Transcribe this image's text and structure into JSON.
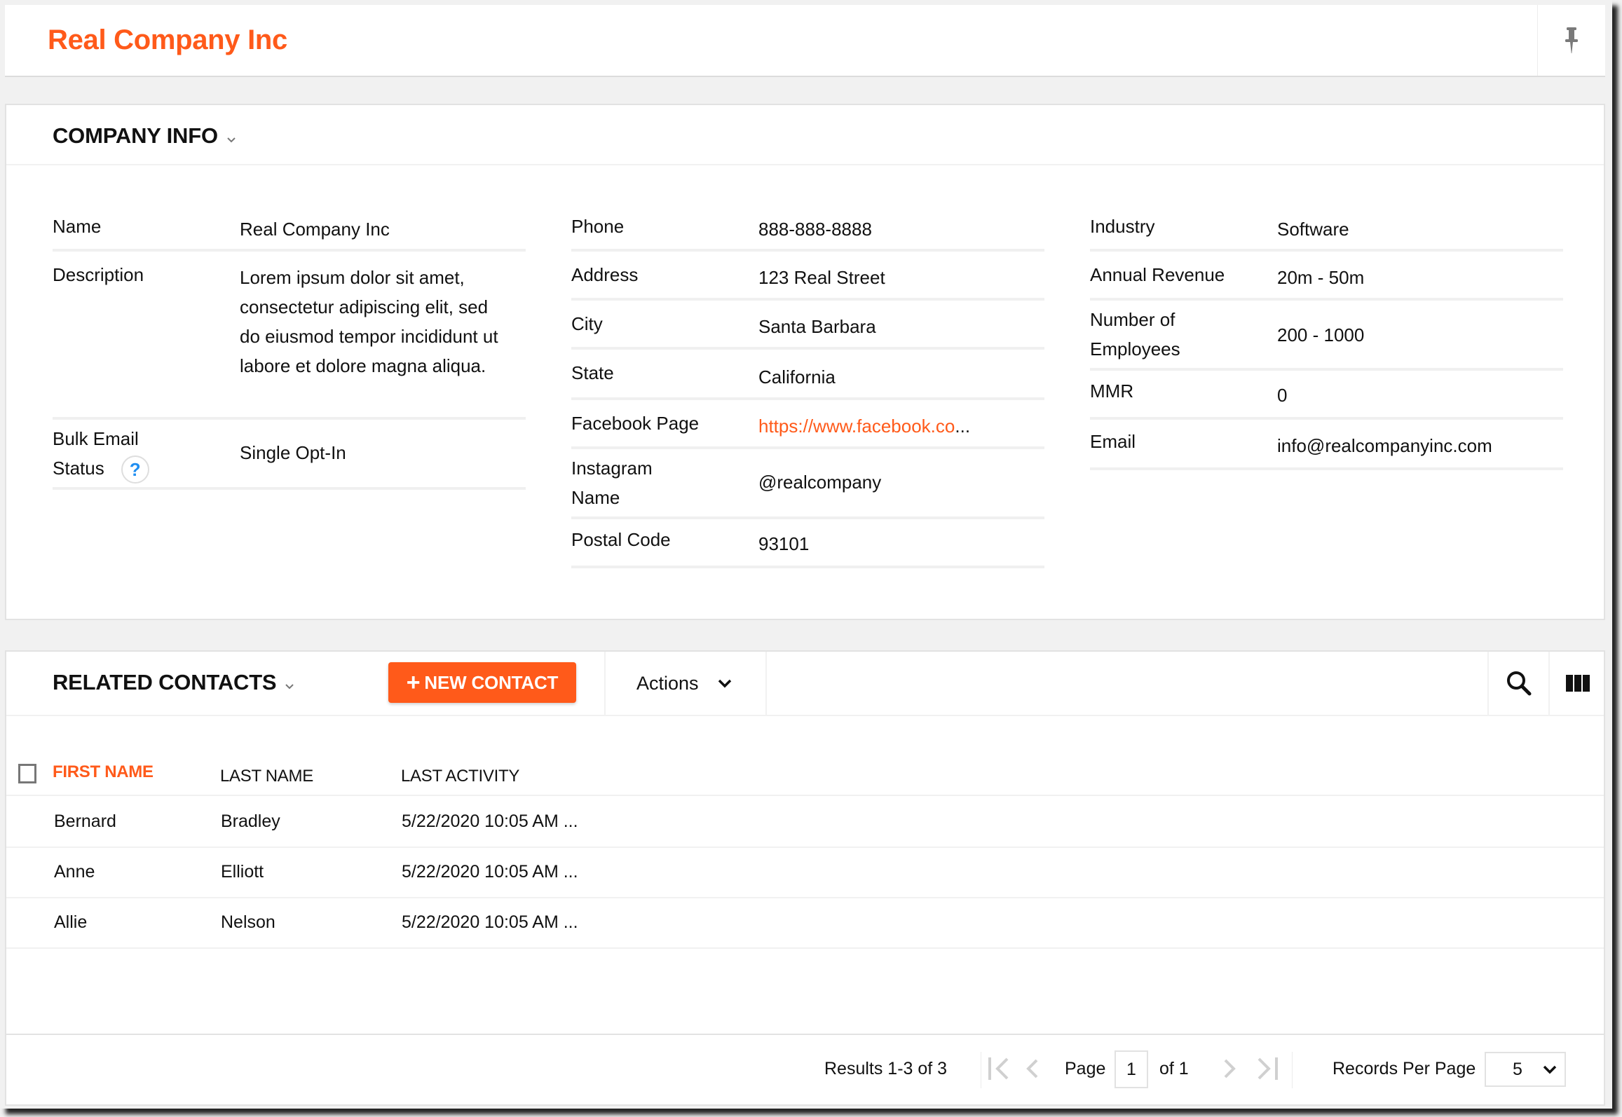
{
  "header": {
    "title": "Real Company Inc",
    "pin_icon": "pushpin-icon"
  },
  "colors": {
    "accent": "#ff5a1a",
    "link": "#ff5a1a",
    "help_icon": "#1f8ef1",
    "page_background": "#f1f1f1"
  },
  "company_info": {
    "title": "COMPANY INFO",
    "columns": [
      [
        {
          "label": "Name",
          "value": "Real Company Inc"
        },
        {
          "label": "Description",
          "value": "Lorem ipsum dolor sit amet, consectetur adipiscing elit, sed do eiusmod tempor incididunt ut labore et dolore magna aliqua."
        },
        {
          "label": "Bulk Email Status",
          "value": "Single Opt-In",
          "help_icon": "?"
        }
      ],
      [
        {
          "label": "Phone",
          "value": "888-888-8888"
        },
        {
          "label": "Address",
          "value": "123 Real Street"
        },
        {
          "label": "City",
          "value": "Santa Barbara"
        },
        {
          "label": "State",
          "value": "California"
        },
        {
          "label": "Facebook Page",
          "value": "https://www.facebook.co",
          "ellipsis": "..."
        },
        {
          "label": "Instagram Name",
          "value": "@realcompany"
        },
        {
          "label": "Postal Code",
          "value": "93101"
        }
      ],
      [
        {
          "label": "Industry",
          "value": "Software"
        },
        {
          "label": "Annual Revenue",
          "value": "20m - 50m"
        },
        {
          "label": "Number of Employees",
          "value": "200 - 1000"
        },
        {
          "label": "MMR",
          "value": "0"
        },
        {
          "label": "Email",
          "value": "info@realcompanyinc.com"
        }
      ]
    ]
  },
  "related_contacts": {
    "title": "RELATED CONTACTS",
    "new_contact_label": "NEW CONTACT",
    "new_contact_plus": "+",
    "actions_label": "Actions",
    "columns": [
      "FIRST NAME",
      "LAST NAME",
      "LAST ACTIVITY"
    ],
    "sorted_column": "FIRST NAME",
    "rows": [
      {
        "first": "Bernard",
        "last": "Bradley",
        "activity": "5/22/2020 10:05 AM ..."
      },
      {
        "first": "Anne",
        "last": "Elliott",
        "activity": "5/22/2020 10:05 AM ..."
      },
      {
        "first": "Allie",
        "last": "Nelson",
        "activity": "5/22/2020 10:05 AM ..."
      }
    ],
    "pagination": {
      "results_text": "Results 1-3 of 3",
      "page_label": "Page",
      "current_page": "1",
      "of_text": "of 1",
      "records_per_page_label": "Records Per Page",
      "records_per_page": "5"
    }
  }
}
